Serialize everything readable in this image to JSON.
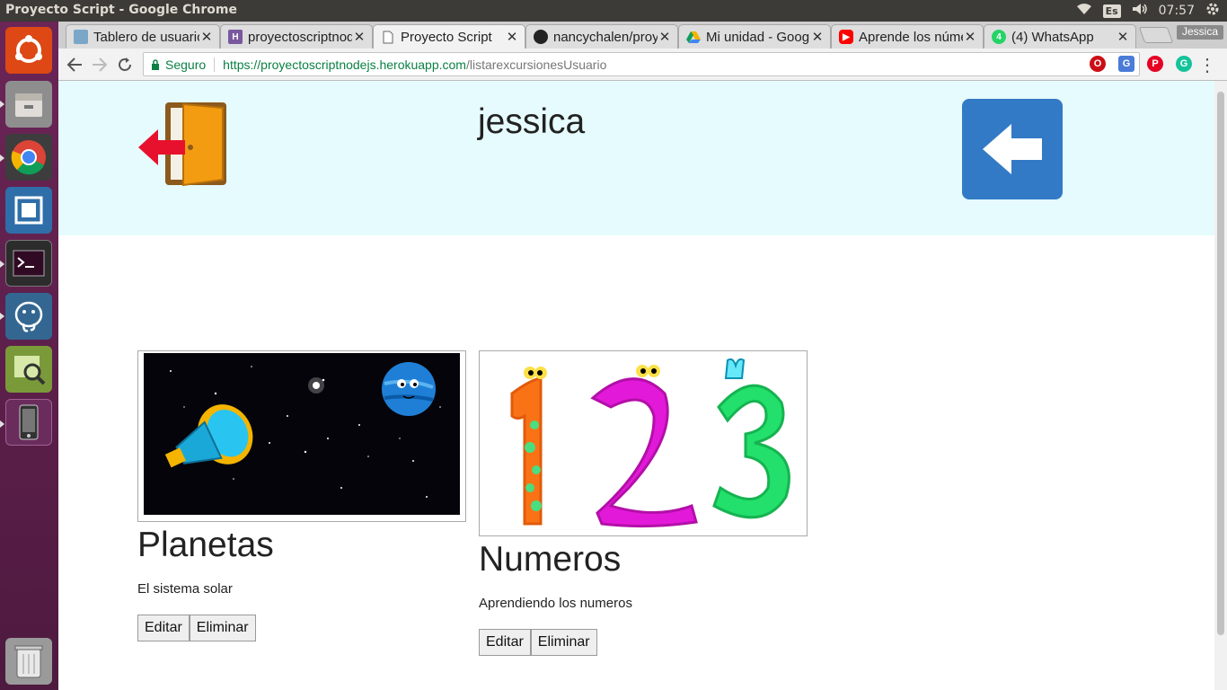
{
  "window": {
    "title": "Proyecto Script - Google Chrome"
  },
  "tray": {
    "language": "Es",
    "time": "07:57"
  },
  "launcher": [
    {
      "name": "ubuntu-dash-icon",
      "color": "#dd4814"
    },
    {
      "name": "files-icon",
      "color": "#8e8e8e"
    },
    {
      "name": "chrome-icon",
      "color": "#4285f4"
    },
    {
      "name": "workspace-switcher-icon",
      "color": "#2f6ea8"
    },
    {
      "name": "terminal-icon",
      "color": "#2c2c2c"
    },
    {
      "name": "postgresql-icon",
      "color": "#336791"
    },
    {
      "name": "system-monitor-icon",
      "color": "#7a9a3a"
    },
    {
      "name": "phone-device-icon",
      "color": "#6a2c5c"
    },
    {
      "name": "trash-icon",
      "color": "#9a9a9a"
    }
  ],
  "tabs": [
    {
      "title": "Tablero de usuario",
      "favicon": "board",
      "color": "#7aa7c7",
      "active": false
    },
    {
      "title": "proyectoscriptnodejs",
      "favicon": "H",
      "color": "#79589f",
      "active": false
    },
    {
      "title": "Proyecto Script",
      "favicon": "page",
      "color": "#777777",
      "active": true
    },
    {
      "title": "nancychalen/proyecto",
      "favicon": "github",
      "color": "#222222",
      "active": false
    },
    {
      "title": "Mi unidad - Google Drive",
      "favicon": "drive",
      "color": "#0f9d58",
      "active": false
    },
    {
      "title": "Aprende los números",
      "favicon": "youtube",
      "color": "#ff0000",
      "active": false
    },
    {
      "title": "(4) WhatsApp",
      "favicon": "whatsapp",
      "color": "#25d366",
      "active": false
    }
  ],
  "profile_name": "Jessica",
  "omnibox": {
    "secure_label": "Seguro",
    "url_host": "https://proyectoscriptnodejs.herokuapp.com",
    "url_path": "/listarexcursionesUsuario"
  },
  "header": {
    "username": "jessica"
  },
  "cards": [
    {
      "title": "Planetas",
      "description": "El sistema solar",
      "image": "space-telescope-planet",
      "edit_label": "Editar",
      "delete_label": "Eliminar"
    },
    {
      "title": "Numeros",
      "description": "Aprendiendo los numeros",
      "image": "colorful-numbers-123",
      "edit_label": "Editar",
      "delete_label": "Eliminar"
    }
  ]
}
